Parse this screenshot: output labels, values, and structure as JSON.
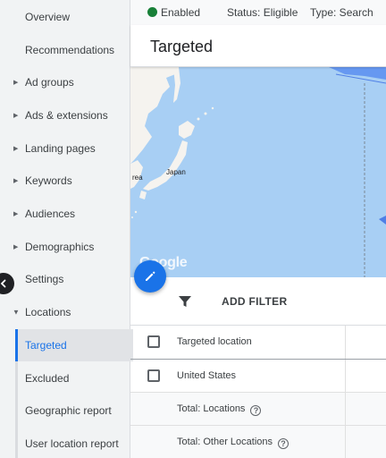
{
  "sidebar": {
    "items": [
      {
        "label": "Overview"
      },
      {
        "label": "Recommendations"
      },
      {
        "label": "Ad groups"
      },
      {
        "label": "Ads & extensions"
      },
      {
        "label": "Landing pages"
      },
      {
        "label": "Keywords"
      },
      {
        "label": "Audiences"
      },
      {
        "label": "Demographics"
      },
      {
        "label": "Settings"
      },
      {
        "label": "Locations"
      }
    ],
    "sub_items": [
      {
        "label": "Targeted",
        "active": true
      },
      {
        "label": "Excluded"
      },
      {
        "label": "Geographic report"
      },
      {
        "label": "User location report"
      }
    ]
  },
  "status_bar": {
    "enabled": "Enabled",
    "status": "Status: Eligible",
    "type": "Type: Search",
    "enabled_color": "#188038"
  },
  "page": {
    "title": "Targeted"
  },
  "map": {
    "labels": {
      "japan": "Japan",
      "korea": "rea"
    },
    "logo": "Google"
  },
  "filter": {
    "add_filter": "ADD FILTER"
  },
  "table": {
    "header": "Targeted location",
    "rows": [
      {
        "label": "United States"
      }
    ],
    "totals": [
      {
        "label": "Total: Locations"
      },
      {
        "label": "Total: Other Locations"
      }
    ],
    "help_glyph": "?"
  },
  "colors": {
    "accent": "#1a73e8",
    "map_water": "#a8cff4",
    "map_land": "#f5f3ef"
  }
}
